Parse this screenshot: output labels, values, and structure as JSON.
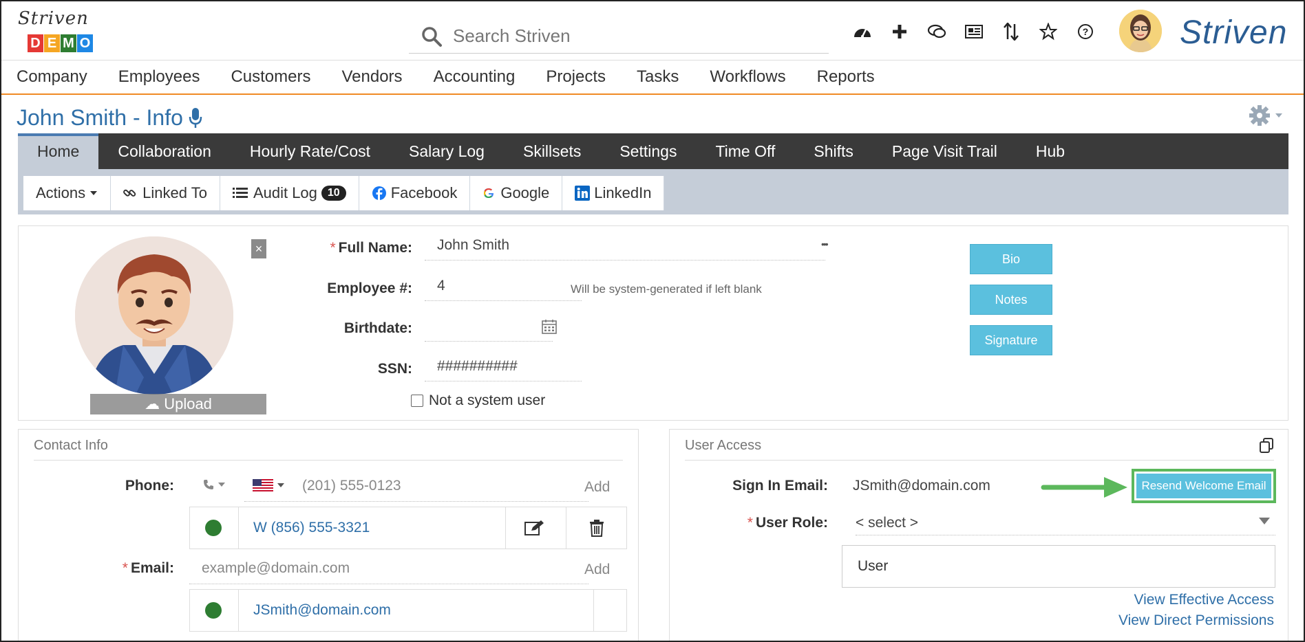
{
  "header": {
    "logo_script": "Striven",
    "logo_demo_letters": [
      "D",
      "E",
      "M",
      "O"
    ],
    "logo_demo_colors": [
      "#e53935",
      "#f5a623",
      "#2e7d32",
      "#1e88e5"
    ],
    "search_placeholder": "Search Striven",
    "brand": "Striven",
    "icons": [
      "dashboard-icon",
      "plus-icon",
      "chat-icon",
      "news-icon",
      "sort-icon",
      "star-icon",
      "help-icon"
    ]
  },
  "main_nav": [
    "Company",
    "Employees",
    "Customers",
    "Vendors",
    "Accounting",
    "Projects",
    "Tasks",
    "Workflows",
    "Reports"
  ],
  "page": {
    "title": "John Smith - Info"
  },
  "tabs": [
    "Home",
    "Collaboration",
    "Hourly Rate/Cost",
    "Salary Log",
    "Skillsets",
    "Settings",
    "Time Off",
    "Shifts",
    "Page Visit Trail",
    "Hub"
  ],
  "sub_toolbar": {
    "actions": "Actions",
    "linked_to": "Linked To",
    "audit_log": "Audit Log",
    "audit_count": "10",
    "facebook": "Facebook",
    "google": "Google",
    "linkedin": "LinkedIn"
  },
  "info": {
    "upload_label": "Upload",
    "close_glyph": "×",
    "full_name_label": "Full Name:",
    "full_name_value": "John Smith",
    "employee_no_label": "Employee #:",
    "employee_no_value": "4",
    "employee_no_hint": "Will be system-generated if left blank",
    "birthdate_label": "Birthdate:",
    "birthdate_value": "",
    "ssn_label": "SSN:",
    "ssn_value": "##########",
    "not_system_user": "Not a system user",
    "more_glyph": "•••",
    "side_buttons": [
      "Bio",
      "Notes",
      "Signature"
    ]
  },
  "contact": {
    "title": "Contact Info",
    "phone_label": "Phone:",
    "phone_placeholder": "(201) 555-0123",
    "add_label": "Add",
    "phone_entry": "W (856) 555-3321",
    "email_label": "Email:",
    "email_placeholder": "example@domain.com",
    "email_entry": "JSmith@domain.com"
  },
  "access": {
    "title": "User Access",
    "sign_in_label": "Sign In Email:",
    "sign_in_value": "JSmith@domain.com",
    "resend_button": "Resend Welcome Email",
    "role_label": "User Role:",
    "role_value": "< select >",
    "role_option": "User",
    "link_effective": "View Effective Access",
    "link_direct": "View Direct Permissions"
  },
  "colors": {
    "accent_blue": "#2f6fa8",
    "nav_underline": "#f08a24",
    "tab_bar": "#3a3a3a",
    "button_info": "#5bc0de",
    "highlight_green": "#5cb85c"
  }
}
